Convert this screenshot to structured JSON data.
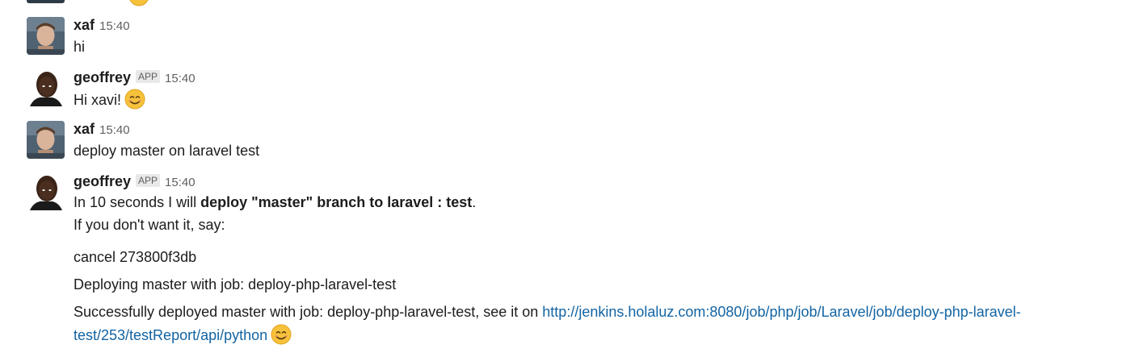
{
  "messages": [
    {
      "author": "xaf",
      "time": "15:40",
      "lines": [
        "hi"
      ]
    },
    {
      "author": "geoffrey",
      "badge": "APP",
      "time": "15:40",
      "lines": [
        "Hi xavi!"
      ]
    },
    {
      "author": "xaf",
      "time": "15:40",
      "lines": [
        "deploy master on laravel test"
      ]
    },
    {
      "author": "geoffrey",
      "badge": "APP",
      "time": "15:40",
      "line1_prefix": "In 10 seconds I will ",
      "line1_bold": "deploy \"master\" branch to laravel : test",
      "line1_suffix": ".",
      "line2": "If you don't want it, say:",
      "line3": "cancel 273800f3db",
      "line4": "Deploying master with job: deploy-php-laravel-test",
      "line5_prefix": "Successfully deployed master with job: deploy-php-laravel-test, see it on ",
      "link_part1": "http://jenkins.holaluz.com:8080/job/php/job/Laravel/job/deploy-php-laravel-",
      "link_part2": "test/253/testReport/api/python"
    }
  ],
  "icons": {
    "emoji": "smile-emoji-icon",
    "avatar_xaf": "avatar-xaf",
    "avatar_geoffrey": "avatar-geoffrey"
  },
  "colors": {
    "link": "#1264a3",
    "badge_bg": "#e8e8e8",
    "timestamp": "#616061"
  }
}
